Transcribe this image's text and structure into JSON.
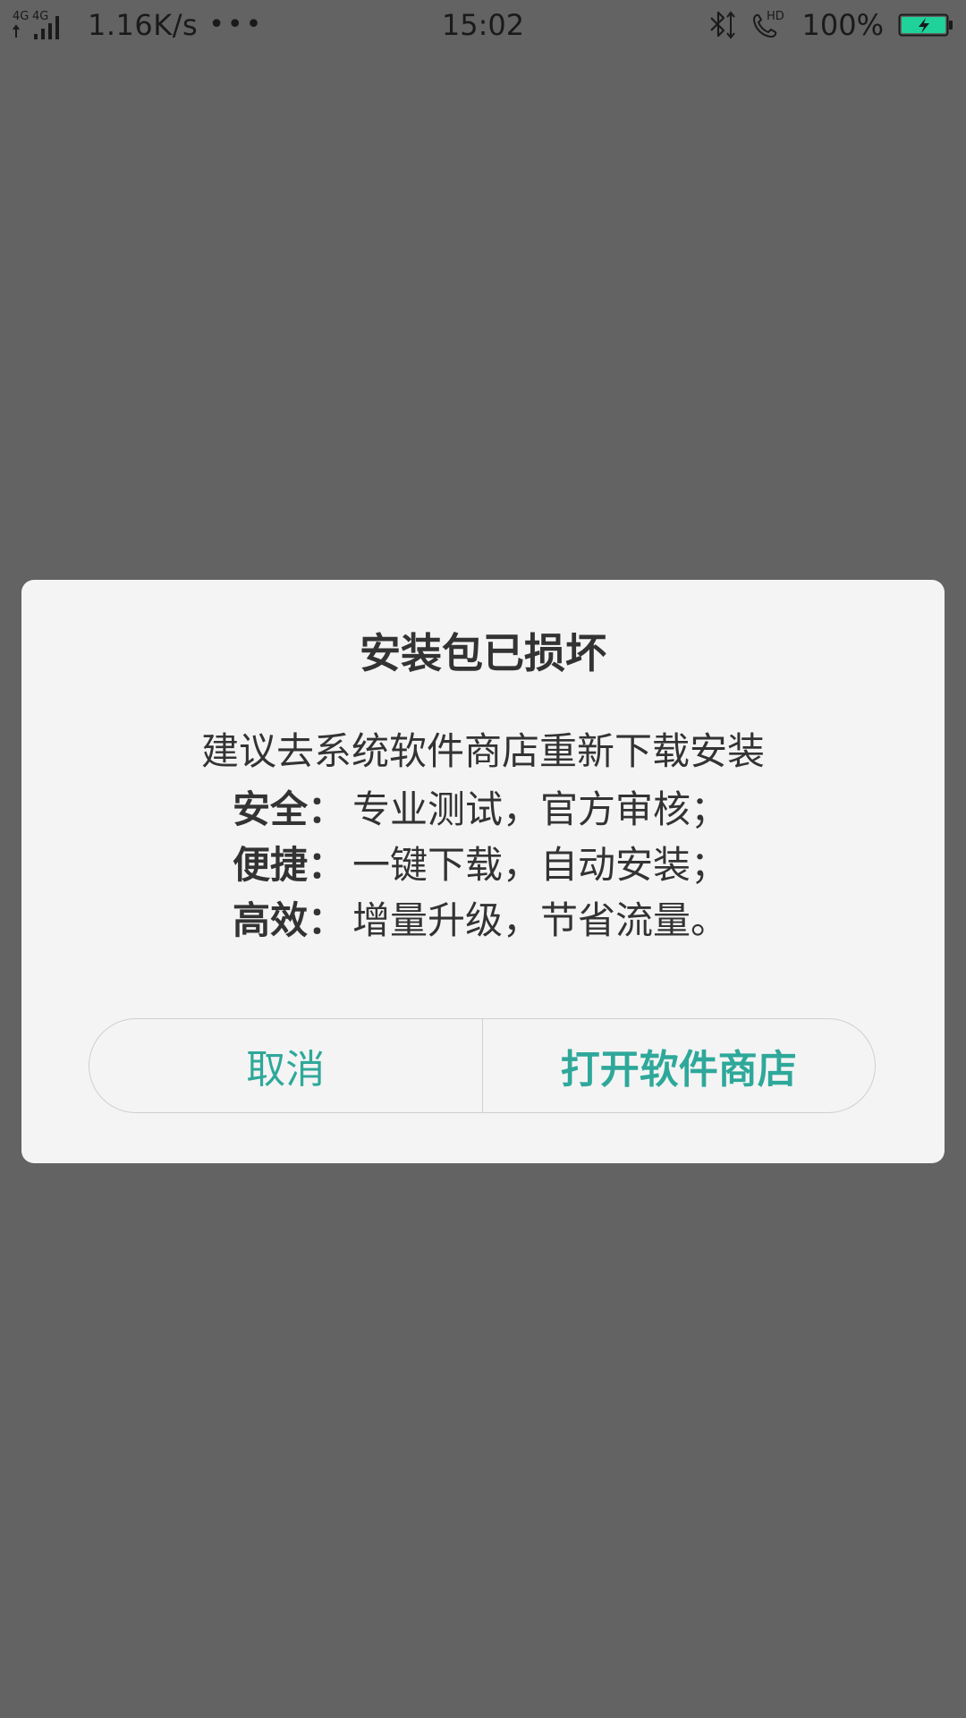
{
  "status_bar": {
    "network_label": "4G 4G",
    "net_speed": "1.16K/s",
    "more": "•••",
    "time": "15:02",
    "battery_percent": "100%",
    "battery_level": 100,
    "battery_color": "#1fd29a",
    "icons": [
      "signal-icon",
      "bluetooth-icon",
      "hd-call-icon",
      "battery-charging-icon"
    ]
  },
  "dialog": {
    "title": "安装包已损坏",
    "message": "建议去系统软件商店重新下载安装",
    "features": [
      {
        "key": "安全：",
        "value": "专业测试，官方审核；"
      },
      {
        "key": "便捷：",
        "value": "一键下载，自动安装；"
      },
      {
        "key": "高效：",
        "value": "增量升级，节省流量。"
      }
    ],
    "cancel_label": "取消",
    "open_store_label": "打开软件商店",
    "accent_color": "#2ea89a"
  }
}
